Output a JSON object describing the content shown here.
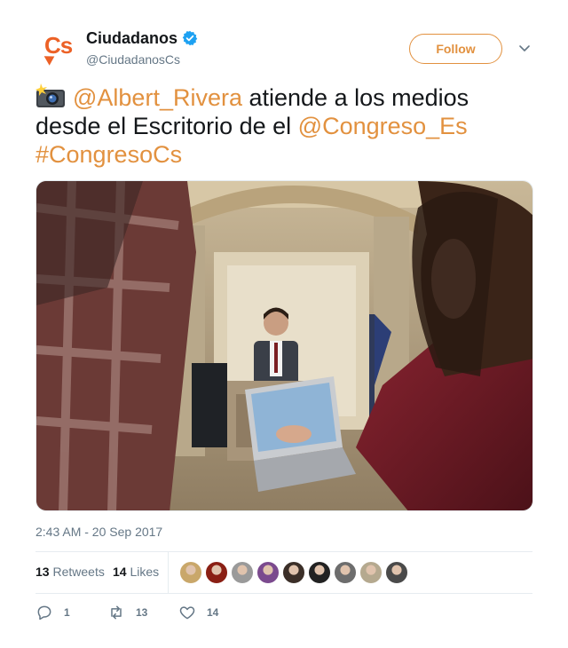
{
  "account": {
    "display_name": "Ciudadanos",
    "screen_name": "@CiudadanosCs",
    "avatar_text": "Cs",
    "verified": true
  },
  "follow_label": "Follow",
  "tweet": {
    "mention_1": "@Albert_Rivera",
    "text_1": " atiende a los medios desde el Escritorio de el ",
    "mention_2": "@Congreso_Es",
    "hashtag": "#CongresoCs",
    "emoji_icon": "camera-flash-icon"
  },
  "timestamp": "2:43 AM - 20 Sep 2017",
  "stats": {
    "retweets_count": "13",
    "retweets_label": "Retweets",
    "likes_count": "14",
    "likes_label": "Likes"
  },
  "liker_avatars": [
    {
      "name": "liker-avatar-1",
      "color": "#c9a76a"
    },
    {
      "name": "liker-avatar-2",
      "color": "#8a1f14"
    },
    {
      "name": "liker-avatar-3",
      "color": "#9a9a9a"
    },
    {
      "name": "liker-avatar-4",
      "color": "#7b4a8e"
    },
    {
      "name": "liker-avatar-5",
      "color": "#3b2f28"
    },
    {
      "name": "liker-avatar-6",
      "color": "#222222"
    },
    {
      "name": "liker-avatar-7",
      "color": "#6d6d6d"
    },
    {
      "name": "liker-avatar-8",
      "color": "#b5a98f"
    },
    {
      "name": "liker-avatar-9",
      "color": "#4a4a4a"
    }
  ],
  "actions": {
    "reply_count": "1",
    "retweet_count": "13",
    "like_count": "14"
  },
  "colors": {
    "accent": "#e2913f",
    "brand": "#ec6126",
    "verified": "#1da1f2",
    "muted": "#657786"
  }
}
